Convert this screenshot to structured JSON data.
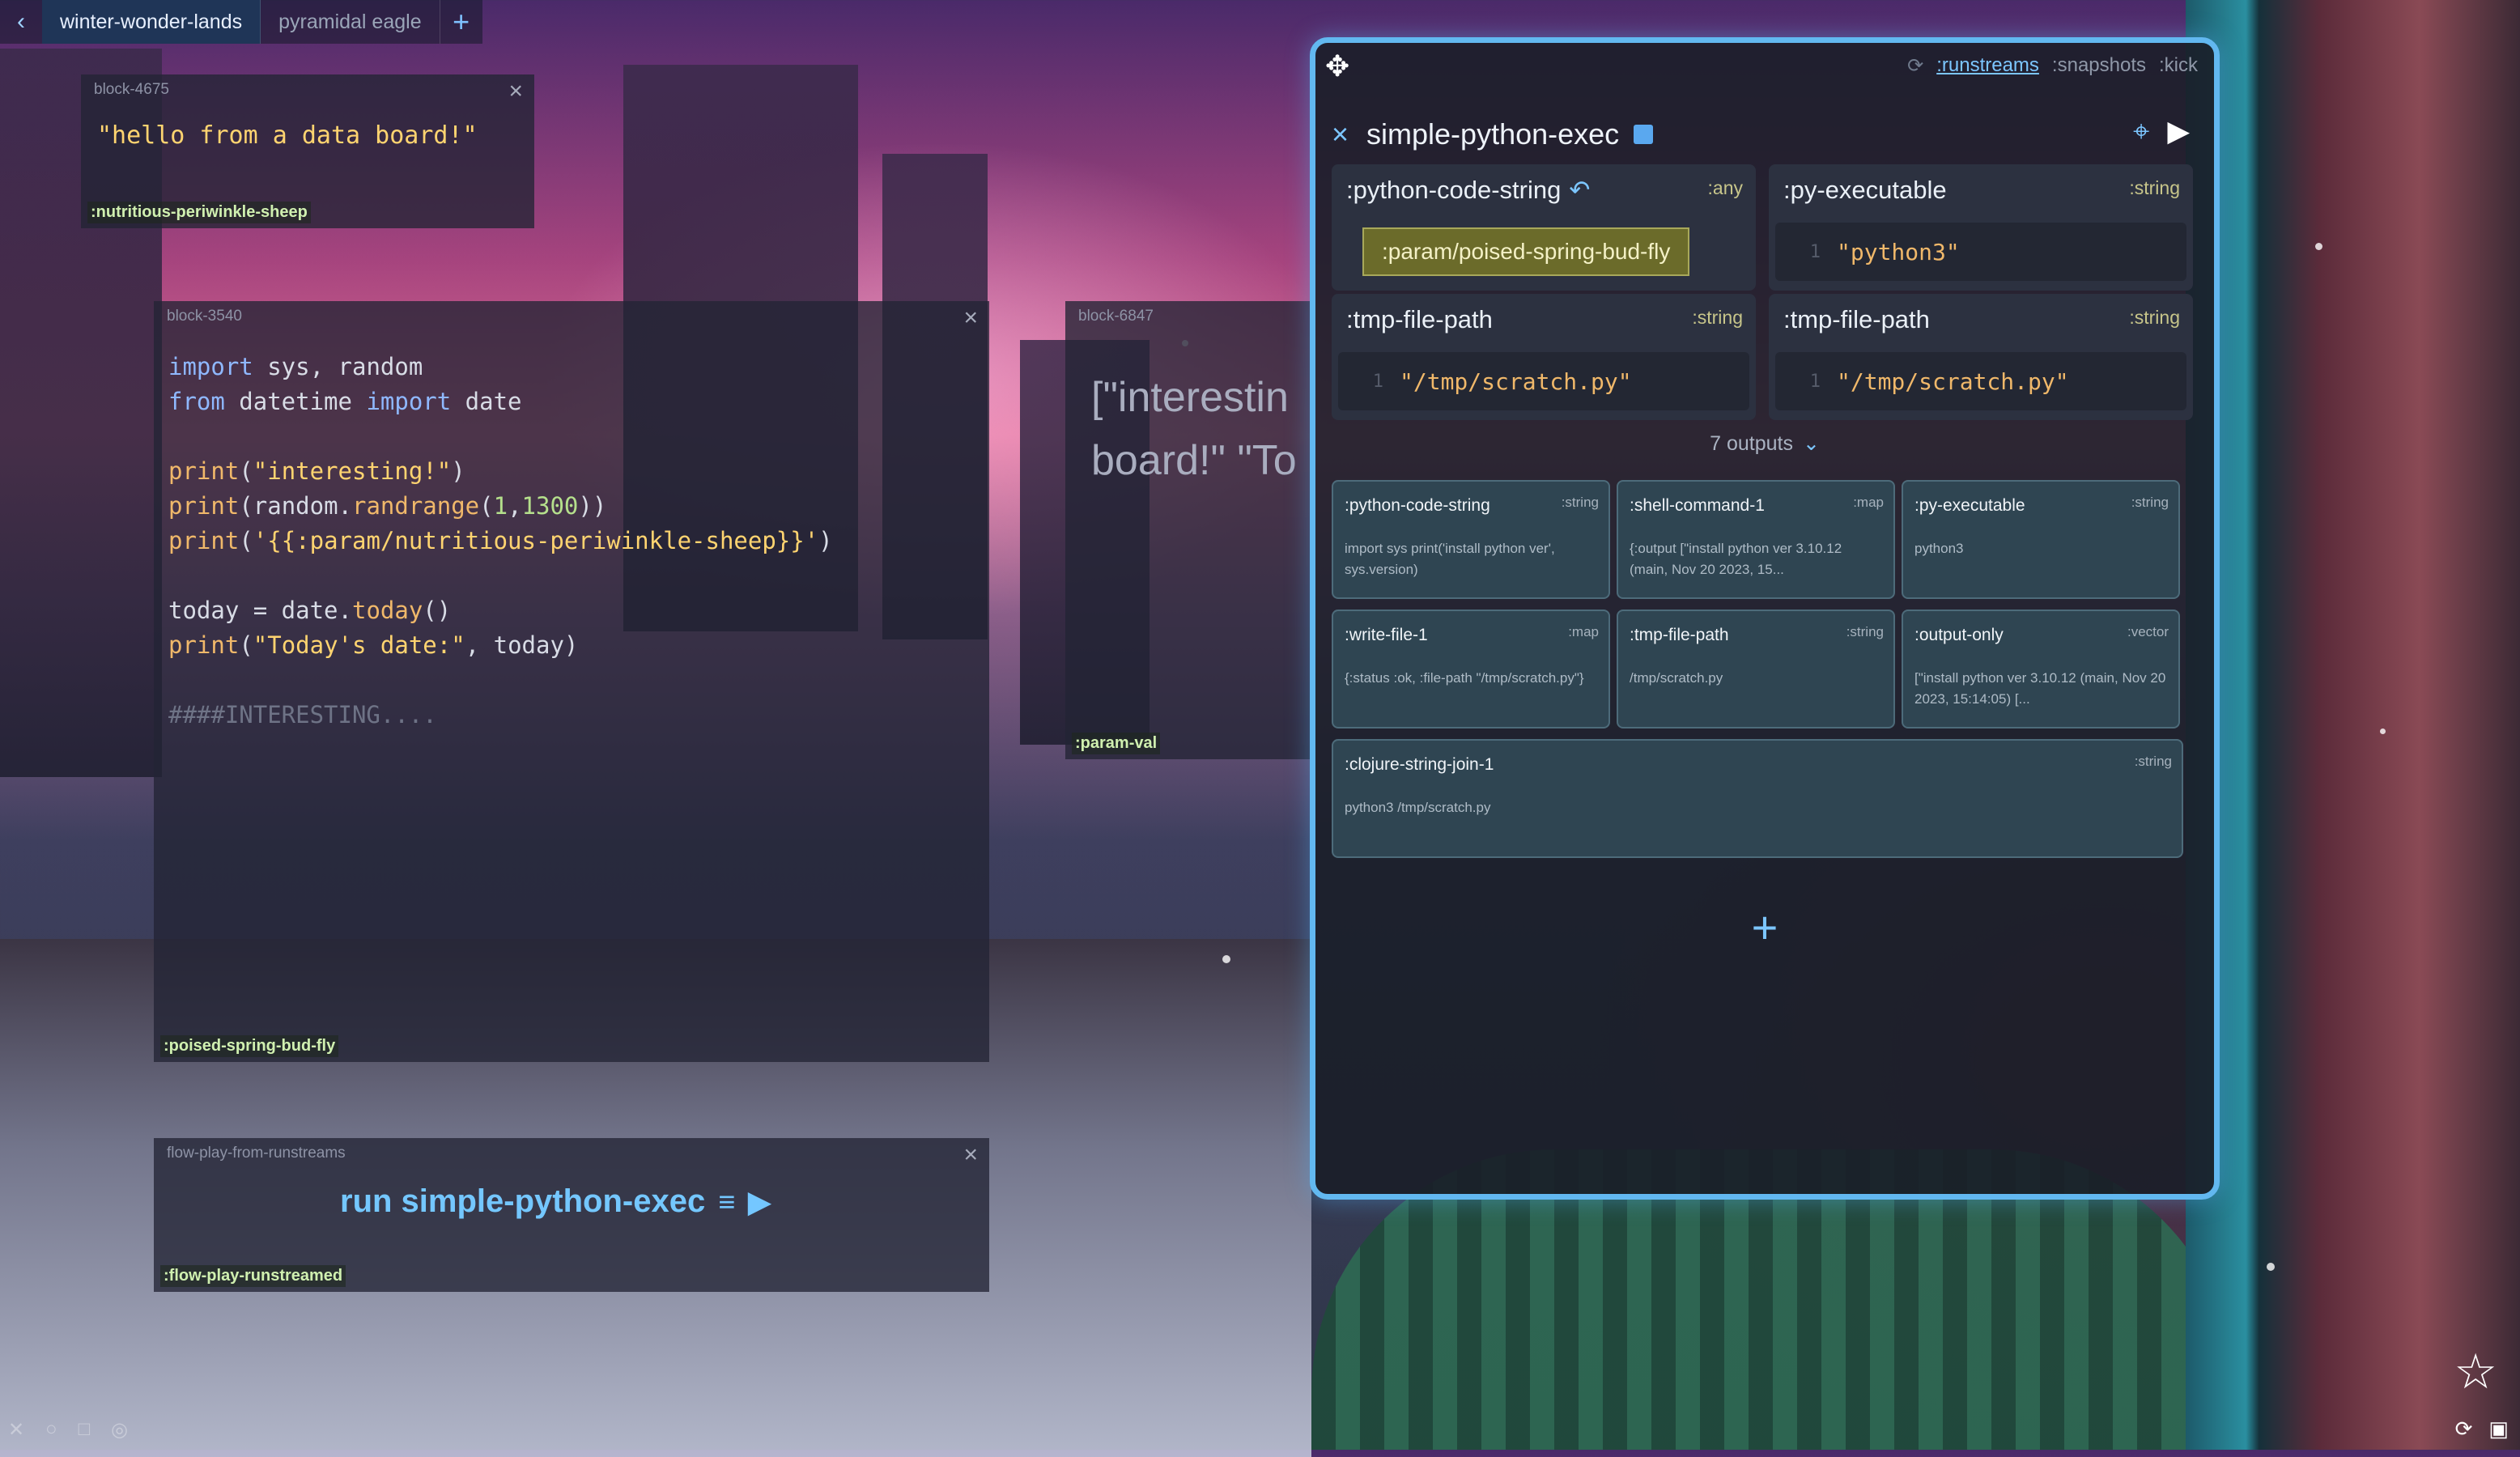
{
  "tabs": {
    "nav_back_icon": "chevron-left-icon",
    "items": [
      "winter-wonder-lands",
      "pyramidal eagle"
    ],
    "add_icon": "plus-icon"
  },
  "blocks": {
    "hello": {
      "id": "block-4675",
      "content": "\"hello from a data board!\"",
      "tag": ":nutritious-periwinkle-sheep"
    },
    "code": {
      "id": "block-3540",
      "tag": ":poised-spring-bud-fly",
      "lines": [
        "import sys, random",
        "from datetime import date",
        "",
        "print(\"interesting!\")",
        "print(random.randrange(1,1300))",
        "print('{{:param/nutritious-periwinkle-sheep}}')",
        "",
        "today = date.today()",
        "print(\"Today's date:\", today)",
        "",
        "####INTERESTING...."
      ]
    },
    "param": {
      "id": "block-6847",
      "content": "[\"interestin\nboard!\" \"To",
      "tag": ":param-val"
    },
    "flow": {
      "id": "flow-play-from-runstreams",
      "label": "run simple-python-exec",
      "tag": ":flow-play-runstreamed"
    }
  },
  "panel": {
    "links": [
      ":runstreams",
      ":snapshots",
      ":kick"
    ],
    "title": "simple-python-exec",
    "inputs": [
      {
        "name": ":python-code-string",
        "type": ":any",
        "value": ":param/poised-spring-bud-fly",
        "kind": "param"
      },
      {
        "name": ":py-executable",
        "type": ":string",
        "value": "\"python3\"",
        "line": "1"
      },
      {
        "name": ":tmp-file-path",
        "type": ":string",
        "value": "\"/tmp/scratch.py\"",
        "line": "1"
      },
      {
        "name": ":tmp-file-path",
        "type": ":string",
        "value": "\"/tmp/scratch.py\"",
        "line": "1"
      }
    ],
    "outputs_label": "7 outputs",
    "outputs": [
      {
        "name": ":python-code-string",
        "type": ":string",
        "value": "import sys print('install python ver', sys.version)"
      },
      {
        "name": ":shell-command-1",
        "type": ":map",
        "value": "{:output [\"install python ver 3.10.12 (main, Nov 20 2023, 15..."
      },
      {
        "name": ":py-executable",
        "type": ":string",
        "value": "python3"
      },
      {
        "name": ":write-file-1",
        "type": ":map",
        "value": "{:status :ok, :file-path \"/tmp/scratch.py\"}"
      },
      {
        "name": ":tmp-file-path",
        "type": ":string",
        "value": "/tmp/scratch.py"
      },
      {
        "name": ":output-only",
        "type": ":vector",
        "value": "[\"install python ver 3.10.12 (main, Nov 20 2023, 15:14:05) [..."
      },
      {
        "name": ":clojure-string-join-1",
        "type": ":string",
        "value": "python3 /tmp/scratch.py"
      }
    ]
  },
  "accent": "#62b8f0"
}
